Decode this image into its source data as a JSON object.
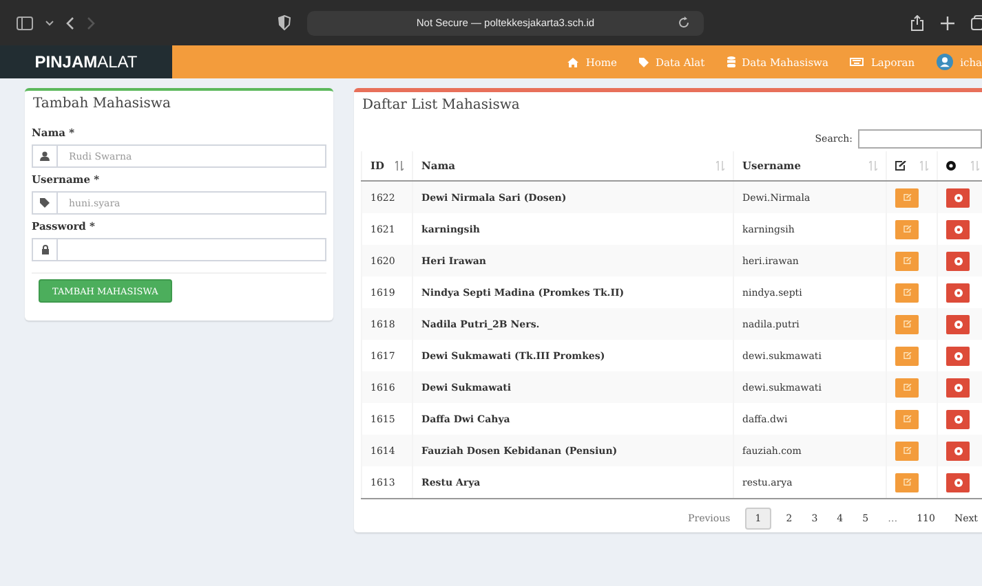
{
  "browser": {
    "address": "Not Secure — poltekkesjakarta3.sch.id"
  },
  "navbar": {
    "logo_bold": "PINJAM",
    "logo_light": "ALAT",
    "items": [
      {
        "label": "Home"
      },
      {
        "label": "Data Alat"
      },
      {
        "label": "Data Mahasiswa"
      },
      {
        "label": "Laporan"
      },
      {
        "label": "icha"
      }
    ]
  },
  "form": {
    "title": "Tambah Mahasiswa",
    "fields": [
      {
        "label": "Nama *",
        "placeholder": "Rudi Swarna"
      },
      {
        "label": "Username *",
        "placeholder": "huni.syara"
      },
      {
        "label": "Password *",
        "kind": "password"
      }
    ],
    "submit": "TAMBAH MAHASISWA"
  },
  "list": {
    "title": "Daftar List Mahasiswa",
    "search_label": "Search:",
    "columns": [
      {
        "label": "ID",
        "kind": "text",
        "sorted": true
      },
      {
        "label": "Nama",
        "kind": "text",
        "sorted": false
      },
      {
        "label": "Username",
        "kind": "text",
        "sorted": false
      },
      {
        "kind": "edit",
        "sorted": false
      },
      {
        "kind": "delete",
        "sorted": false
      }
    ],
    "rows": [
      {
        "id": "1622",
        "nama": "Dewi Nirmala Sari (Dosen)",
        "username": "Dewi.Nirmala"
      },
      {
        "id": "1621",
        "nama": "karningsih",
        "username": "karningsih"
      },
      {
        "id": "1620",
        "nama": "Heri Irawan",
        "username": "heri.irawan"
      },
      {
        "id": "1619",
        "nama": "Nindya Septi Madina (Promkes Tk.II)",
        "username": "nindya.septi"
      },
      {
        "id": "1618",
        "nama": "Nadila Putri_2B Ners.",
        "username": "nadila.putri"
      },
      {
        "id": "1617",
        "nama": "Dewi Sukmawati (Tk.III Promkes)",
        "username": "dewi.sukmawati"
      },
      {
        "id": "1616",
        "nama": "Dewi Sukmawati",
        "username": "dewi.sukmawati"
      },
      {
        "id": "1615",
        "nama": "Daffa Dwi Cahya",
        "username": "daffa.dwi"
      },
      {
        "id": "1614",
        "nama": "Fauziah Dosen Kebidanan (Pensiun)",
        "username": "fauziah.com"
      },
      {
        "id": "1613",
        "nama": "Restu Arya",
        "username": "restu.arya"
      }
    ],
    "pagination": {
      "previous": "Previous",
      "pages": [
        {
          "label": "1",
          "selected": true
        },
        {
          "label": "2",
          "selected": false
        },
        {
          "label": "3",
          "selected": false
        },
        {
          "label": "4",
          "selected": false
        },
        {
          "label": "5",
          "selected": false
        }
      ],
      "ellipsis": "…",
      "last": "110",
      "next": "Next"
    }
  }
}
